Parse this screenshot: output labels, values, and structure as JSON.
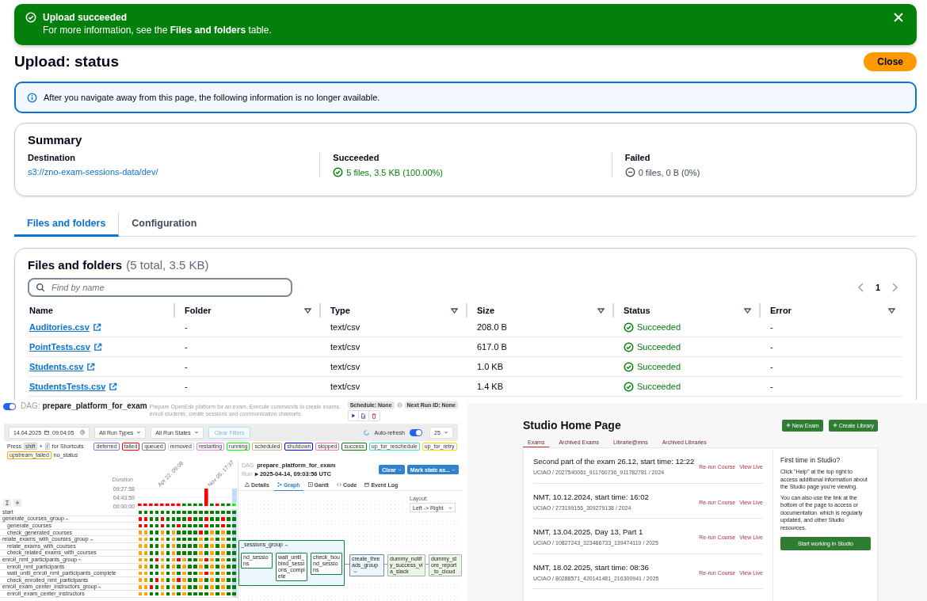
{
  "upload": {
    "flash": {
      "title": "Upload succeeded",
      "message": "For more information, see the **Files and folders** table."
    },
    "title": "Upload: status",
    "close_button": "Close",
    "info": "After you navigate away from this page, the following information is no longer available.",
    "summary": {
      "title": "Summary",
      "items": [
        {
          "label": "Destination",
          "value": "s3://zno-exam-sessions-data/dev/",
          "kind": "link"
        },
        {
          "label": "Succeeded",
          "value": "5 files, 3.5 KB (100.00%)",
          "kind": "success"
        },
        {
          "label": "Failed",
          "value": "0 files, 0 B (0%)",
          "kind": "none"
        }
      ]
    },
    "tabs": [
      {
        "label": "Files and folders",
        "selected": true
      },
      {
        "label": "Configuration",
        "selected": false
      }
    ],
    "table": {
      "title": "Files and folders",
      "count": "(5 total, 3.5 KB)",
      "search": {
        "placeholder": "Find by name"
      },
      "page": "1",
      "columns": [
        {
          "label": "Name",
          "sortable": false
        },
        {
          "label": "Folder",
          "sortable": true
        },
        {
          "label": "Type",
          "sortable": true
        },
        {
          "label": "Size",
          "sortable": true
        },
        {
          "label": "Status",
          "sortable": true
        },
        {
          "label": "Error",
          "sortable": true
        }
      ],
      "rows": [
        {
          "name": "Auditories.csv",
          "folder": "-",
          "type": "text/csv",
          "size": "208.0 B",
          "status": "Succeeded",
          "error": "-"
        },
        {
          "name": "PointTests.csv",
          "folder": "-",
          "type": "text/csv",
          "size": "617.0 B",
          "status": "Succeeded",
          "error": "-"
        },
        {
          "name": "Students.csv",
          "folder": "-",
          "type": "text/csv",
          "size": "1.0 KB",
          "status": "Succeeded",
          "error": "-"
        },
        {
          "name": "StudentsTests.csv",
          "folder": "-",
          "type": "text/csv",
          "size": "1.4 KB",
          "status": "Succeeded",
          "error": "-"
        }
      ]
    }
  },
  "airflow": {
    "active": true,
    "dag_label": "DAG:",
    "dag_name": "prepare_platform_for_exam",
    "description": "Prepare OpenEdx platform for an exam. Execute commands to create exams, enroll students, create sessions and communication channels.",
    "schedule": "Schedule: None",
    "next_run": "Next Run ID: None",
    "filters": {
      "date": "14.04.2025",
      "time": "09:04:05",
      "run_types": "All Run Types",
      "run_states": "All Run States",
      "clear": {
        "label": "Clear Filters",
        "disabled": true
      },
      "auto_refresh": {
        "label": "Auto-refresh",
        "on": true
      },
      "page_size": "25"
    },
    "shortcut": {
      "prefix": "Press",
      "keys": [
        "shift",
        "/"
      ],
      "joiner": "+",
      "suffix": "for Shortcuts"
    },
    "legend": [
      {
        "label": "deferred",
        "color": "#9370db"
      },
      {
        "label": "failed",
        "color": "#ff0000"
      },
      {
        "label": "queued",
        "color": "#808080"
      },
      {
        "label": "removed",
        "color": "#d3d3d3"
      },
      {
        "label": "restarting",
        "color": "#ee82ee"
      },
      {
        "label": "running",
        "color": "#00ff00"
      },
      {
        "label": "scheduled",
        "color": "#d2b48c"
      },
      {
        "label": "shutdown",
        "color": "#0000ff"
      },
      {
        "label": "skipped",
        "color": "#ff69b4"
      },
      {
        "label": "success",
        "color": "#008000"
      },
      {
        "label": "up_for_reschedule",
        "color": "#40e0d0"
      },
      {
        "label": "up_for_retry",
        "color": "#ffd700"
      },
      {
        "label": "upstream_failed",
        "color": "#ffa500"
      }
    ],
    "no_status": "no_status",
    "duration": {
      "chart_data": {
        "type": "bar",
        "ylabel": "Duration",
        "grid": true,
        "values": [
          5000,
          5000,
          5000,
          5000,
          5000,
          5000,
          5000,
          5000,
          5000,
          5000,
          5000,
          5000,
          34000,
          5000,
          5000,
          5000,
          5000,
          5000
        ],
        "ylim": [
          0,
          34078
        ],
        "yticks": [
          {
            "value": 0,
            "label": "00:00:00"
          },
          {
            "value": 17039,
            "label": "04:43:59"
          },
          {
            "value": 34078,
            "label": "09:27:58"
          }
        ]
      }
    },
    "run_dates": [
      "Apr 22, 09:08",
      "Nov 05, 17:37"
    ],
    "runs": [
      {
        "color": "#ff0000",
        "selected": false
      },
      {
        "color": "#ff0000",
        "selected": false
      },
      {
        "color": "#ff0000",
        "selected": false
      },
      {
        "color": "#ff0000",
        "selected": false
      },
      {
        "color": "#ff0000",
        "selected": false
      },
      {
        "color": "#ff0000",
        "selected": false
      },
      {
        "color": "#ff0000",
        "selected": false
      },
      {
        "color": "#ff0000",
        "selected": false
      },
      {
        "color": "#008000",
        "selected": false
      },
      {
        "color": "#008000",
        "selected": false
      },
      {
        "color": "#008000",
        "selected": false
      },
      {
        "color": "#008000",
        "selected": false
      },
      {
        "color": "#ff0000",
        "selected": false
      },
      {
        "color": "#008000",
        "selected": false
      },
      {
        "color": "#ff0000",
        "selected": false
      },
      {
        "color": "#008000",
        "selected": false
      },
      {
        "color": "#008000",
        "selected": false
      },
      {
        "color": "#00ff00",
        "selected": true
      }
    ],
    "tasks": [
      {
        "name": "start",
        "cells": [
          {
            "color": "#008000"
          },
          {
            "color": "#008000"
          },
          {
            "color": "#008000"
          },
          {
            "color": "#008000"
          },
          {
            "color": "#008000"
          },
          {
            "color": "#008000"
          },
          {
            "color": "#008000"
          },
          {
            "color": "#008000"
          },
          {
            "color": "#008000"
          },
          {
            "color": "#008000"
          },
          {
            "color": "#008000"
          },
          {
            "color": "#008000"
          },
          {
            "color": "#008000"
          },
          {
            "color": "#008000"
          },
          {
            "color": "#008000"
          },
          {
            "color": "#008000"
          },
          {
            "color": "#008000"
          },
          {
            "color": "#008000"
          }
        ]
      },
      {
        "name": "generate_courses_group",
        "expanded": true,
        "cells": [
          {
            "color": "#ff0000"
          },
          {
            "color": "#ff0000"
          },
          {
            "color": "#008000"
          },
          {
            "color": "#008000"
          },
          {
            "color": "#ff0000"
          },
          {
            "color": "#008000"
          },
          {
            "color": "#008000"
          },
          {
            "color": "#008000"
          },
          {
            "color": "#008000"
          },
          {
            "color": "#ff0000"
          },
          {
            "color": "#008000"
          },
          {
            "color": "#008000"
          },
          {
            "color": "#ff0000"
          },
          {
            "color": "#008000"
          },
          {
            "color": "#008000"
          },
          {
            "color": "#ff0000"
          },
          {
            "color": "#008000"
          },
          {
            "color": "#008000"
          }
        ],
        "children": [
          {
            "name": "generate_courses",
            "cells": [
              {
                "color": "#ff0000"
              },
              {
                "color": "#ff0000"
              },
              {
                "color": "#008000"
              },
              {
                "color": "#008000"
              },
              {
                "color": "#ff0000"
              },
              {
                "color": "#008000"
              },
              {
                "color": "#008000"
              },
              {
                "color": "#ff0000"
              },
              {
                "color": "#008000"
              },
              {
                "color": "#008000"
              },
              {
                "color": "#008000"
              },
              {
                "color": "#008000"
              },
              {
                "color": "#ff0000"
              },
              {
                "color": "#008000"
              },
              {
                "color": "#008000"
              },
              {
                "color": "#ff0000"
              },
              {
                "color": "#008000"
              },
              {
                "color": "#008000"
              }
            ]
          },
          {
            "name": "check_generated_courses",
            "cells": [
              {
                "color": "#ffa500"
              },
              {
                "color": "#ffa500"
              },
              {
                "color": "#008000"
              },
              {
                "color": "#008000"
              },
              {
                "color": "#ffa500"
              },
              {
                "color": "#008000"
              },
              {
                "color": "#ffa500"
              },
              {
                "color": "#008000"
              },
              {
                "color": "#008000"
              },
              {
                "color": "#008000"
              },
              {
                "color": "#008000"
              },
              {
                "color": "#ff0000"
              },
              {
                "color": "#008000"
              },
              {
                "color": "#ffa500"
              },
              {
                "color": "#008000"
              },
              {
                "color": "#ffa500"
              },
              {
                "color": "#008000"
              },
              {
                "color": "#008000"
              }
            ]
          }
        ]
      },
      {
        "name": "relate_exams_with_courses_group",
        "expanded": true,
        "cells": [
          {
            "color": "#ffa500"
          },
          {
            "color": "#ffa500"
          },
          {
            "color": "#008000"
          },
          {
            "color": "#008000"
          },
          {
            "color": "#ffa500"
          },
          {
            "color": "#008000"
          },
          {
            "color": "#ffa500"
          },
          {
            "color": "#008000"
          },
          {
            "color": "#008000"
          },
          {
            "color": "#008000"
          },
          {
            "color": "#008000"
          },
          {
            "color": "#ffa500"
          },
          {
            "color": "#008000"
          },
          {
            "color": "#ffa500"
          },
          {
            "color": "#008000"
          },
          {
            "color": "#ffa500"
          },
          {
            "color": "#008000"
          },
          {
            "color": "#008000"
          }
        ],
        "children": [
          {
            "name": "relate_exams_with_courses",
            "cells": [
              {
                "color": "#ffa500"
              },
              {
                "color": "#ffa500"
              },
              {
                "color": "#008000"
              },
              {
                "color": "#008000"
              },
              {
                "color": "#ffa500"
              },
              {
                "color": "#008000"
              },
              {
                "color": "#ffa500"
              },
              {
                "color": "#008000"
              },
              {
                "color": "#008000"
              },
              {
                "color": "#008000"
              },
              {
                "color": "#008000"
              },
              {
                "color": "#ffa500"
              },
              {
                "color": "#008000"
              },
              {
                "color": "#ffa500"
              },
              {
                "color": "#008000"
              },
              {
                "color": "#ffa500"
              },
              {
                "color": "#008000"
              },
              {
                "color": "#008000"
              }
            ]
          },
          {
            "name": "check_related_exams_with_courses",
            "cells": [
              {
                "color": "#ffa500"
              },
              {
                "color": "#ffa500"
              },
              {
                "color": "#008000"
              },
              {
                "color": "#008000"
              },
              {
                "color": "#ffa500"
              },
              {
                "color": "#008000"
              },
              {
                "color": "#ffa500"
              },
              {
                "color": "#008000"
              },
              {
                "color": "#008000"
              },
              {
                "color": "#008000"
              },
              {
                "color": "#008000"
              },
              {
                "color": "#ffa500"
              },
              {
                "color": "#008000"
              },
              {
                "color": "#ffa500"
              },
              {
                "color": "#008000"
              },
              {
                "color": "#ffa500"
              },
              {
                "color": "#008000"
              },
              {
                "color": "#008000"
              }
            ]
          }
        ]
      },
      {
        "name": "enroll_nmt_participants_group",
        "expanded": true,
        "cells": [
          {
            "color": "#ffa500"
          },
          {
            "color": "#ffa500"
          },
          {
            "color": "#008000"
          },
          {
            "color": "#ff0000"
          },
          {
            "color": "#ffa500"
          },
          {
            "color": "#008000"
          },
          {
            "color": "#ffa500"
          },
          {
            "color": "#ff0000"
          },
          {
            "color": "#ffa500"
          },
          {
            "color": "#008000"
          },
          {
            "color": "#008000"
          },
          {
            "color": "#ffa500"
          },
          {
            "color": "#ff0000"
          },
          {
            "color": "#ffa500"
          },
          {
            "color": "#008000"
          },
          {
            "color": "#ffa500"
          },
          {
            "color": "#008000"
          },
          {
            "color": "#008000"
          }
        ],
        "children": [
          {
            "name": "enroll_nmt_participants",
            "cells": [
              {
                "color": "#ffa500"
              },
              {
                "color": "#ffa500"
              },
              {
                "color": "#008000"
              },
              {
                "color": "#008000"
              },
              {
                "color": "#ffa500"
              },
              {
                "color": "#008000"
              },
              {
                "color": "#ffa500"
              },
              {
                "color": "#008000"
              },
              {
                "color": "#ffa500"
              },
              {
                "color": "#008000"
              },
              {
                "color": "#008000"
              },
              {
                "color": "#ffa500"
              },
              {
                "color": "#008000"
              },
              {
                "color": "#ffa500"
              },
              {
                "color": "#008000"
              },
              {
                "color": "#ffa500"
              },
              {
                "color": "#008000"
              },
              {
                "color": "#008000"
              }
            ]
          },
          {
            "name": "wait_until_enroll_nmt_participants_complete",
            "cells": [
              {
                "color": "#ffa500"
              },
              {
                "color": "#ffa500"
              },
              {
                "color": "#008000"
              },
              {
                "color": "#008000"
              },
              {
                "color": "#ffa500"
              },
              {
                "color": "#008000"
              },
              {
                "color": "#ffa500"
              },
              {
                "color": "#008000"
              },
              {
                "color": "#ffa500"
              },
              {
                "color": "#008000"
              },
              {
                "color": "#008000"
              },
              {
                "color": "#ffa500"
              },
              {
                "color": "#ff0000"
              },
              {
                "color": "#ffa500"
              },
              {
                "color": "#008000"
              },
              {
                "color": "#ffa500"
              },
              {
                "color": "#008000"
              },
              {
                "color": "#008000"
              }
            ]
          },
          {
            "name": "check_enrolled_nmt_participants",
            "cells": [
              {
                "color": "#ffa500"
              },
              {
                "color": "#ffa500"
              },
              {
                "color": "#008000"
              },
              {
                "color": "#ff0000"
              },
              {
                "color": "#ffa500"
              },
              {
                "color": "#008000"
              },
              {
                "color": "#ffa500"
              },
              {
                "color": "#ff0000"
              },
              {
                "color": "#ffa500"
              },
              {
                "color": "#008000"
              },
              {
                "color": "#008000"
              },
              {
                "color": "#ffa500"
              },
              {
                "color": "#008000"
              },
              {
                "color": "#ffa500"
              },
              {
                "color": "#008000"
              },
              {
                "color": "#ffa500"
              },
              {
                "color": "#008000"
              },
              {
                "color": "#008000"
              }
            ]
          }
        ]
      },
      {
        "name": "enroll_exam_center_instructors_group",
        "expanded": true,
        "cells": [
          {
            "color": "#ffa500"
          },
          {
            "color": "#ffa500"
          },
          {
            "color": "#ff0000"
          },
          {
            "color": "#008000"
          },
          {
            "color": "#ffa500"
          },
          {
            "color": "#008000"
          },
          {
            "color": "#ffa500"
          },
          {
            "color": "#008000"
          },
          {
            "color": "#ffa500"
          },
          {
            "color": "#008000"
          },
          {
            "color": "#008000"
          },
          {
            "color": "#ffa500"
          },
          {
            "color": "#008000"
          },
          {
            "color": "#ffa500"
          },
          {
            "color": "#008000"
          },
          {
            "color": "#ffa500"
          },
          {
            "color": "#008000"
          },
          {
            "color": "#008000"
          }
        ],
        "children": [
          {
            "name": "enroll_exam_center_instructors",
            "cells": [
              {
                "color": "#ffa500"
              },
              {
                "color": "#ffa500"
              },
              {
                "color": "#008000"
              },
              {
                "color": "#008000"
              },
              {
                "color": "#ffa500"
              },
              {
                "color": "#008000"
              },
              {
                "color": "#ffa500"
              },
              {
                "color": "#008000"
              },
              {
                "color": "#ffa500"
              },
              {
                "color": "#008000"
              },
              {
                "color": "#008000"
              },
              {
                "color": "#008000"
              },
              {
                "color": "#008000"
              },
              {
                "color": "#ffa500"
              },
              {
                "color": "#008000"
              },
              {
                "color": "#ffa500"
              },
              {
                "color": "#008000"
              },
              {
                "color": "#008000"
              }
            ]
          }
        ]
      }
    ],
    "detail": {
      "dag_label": "DAG",
      "dag_name": "prepare_platform_for_exam",
      "run_label": "Run",
      "run": "▸ 2025-04-14, 09:03:56 UTC",
      "clear": "Clear",
      "mark": "Mark state as...",
      "tabs": [
        {
          "label": "Details",
          "selected": false
        },
        {
          "label": "Graph",
          "selected": true
        },
        {
          "label": "Gantt",
          "selected": false
        },
        {
          "label": "Code",
          "selected": false
        },
        {
          "label": "Event Log",
          "selected": false
        }
      ],
      "layout_label": "Layout:",
      "layout": "Left -> Right",
      "nodes": [
        {
          "label": "_sessions_group",
          "kind": "group",
          "color": "#15803d"
        },
        {
          "label": "nd_sessions",
          "kind": "task",
          "color": "#15803d"
        },
        {
          "label": "wait_until_bind_sessions_complete",
          "kind": "task",
          "color": "#15803d"
        },
        {
          "label": "check_bound_sessions",
          "kind": "task",
          "color": "#15803d"
        },
        {
          "label": "create_threads_group",
          "kind": "group",
          "color": "#7a8a96"
        },
        {
          "label": "dummy_notify_success_via_slack",
          "kind": "empty",
          "color": "#a8b0b8"
        },
        {
          "label": "dummy_store_report_to_cloud",
          "kind": "empty",
          "color": "#a8b0b8"
        }
      ]
    }
  },
  "studio": {
    "title": "Studio Home Page",
    "buttons": [
      "New Exam",
      "Create Library"
    ],
    "tabs": [
      {
        "label": "Exams",
        "selected": true
      },
      {
        "label": "Archived Exams",
        "selected": false
      },
      {
        "label": "Librarie@mns",
        "selected": false
      },
      {
        "label": "Archived Libraries",
        "selected": false
      }
    ],
    "courses": [
      {
        "title": "Second part of the exam 26.12, start time: 12:22",
        "meta": "UCIAO / 2027540061_911760736_911782781 / 2024",
        "actions": [
          "Re-run Course",
          "View Live"
        ]
      },
      {
        "title": "NMT, 10.12.2024, start time: 16:02",
        "meta": "UCIAO / 273199156_309279138 / 2024",
        "actions": [
          "Re-run Course",
          "View Live"
        ]
      },
      {
        "title": "NMT, 13.04.2025, Day 13, Part 1",
        "meta": "UCIAO / 10827243_323466733_139474110 / 2025",
        "actions": [
          "Re-run Course",
          "View Live"
        ]
      },
      {
        "title": "NMT, 18.02.2025, start time: 08:36",
        "meta": "UCIAO / 80288571_420141481_216300941 / 2025",
        "actions": [
          "Re-run Course",
          "View Live"
        ]
      }
    ],
    "help": {
      "title": "First time in Studio?",
      "paragraphs": [
        "Click \"Help\" at the top right to access additional information about the Studio page you're viewing.",
        "You can also use the link at the bottom of the page to access or documentation.  which is regularly updated, and other Studio resources."
      ],
      "button": "Start working in Studio"
    }
  }
}
